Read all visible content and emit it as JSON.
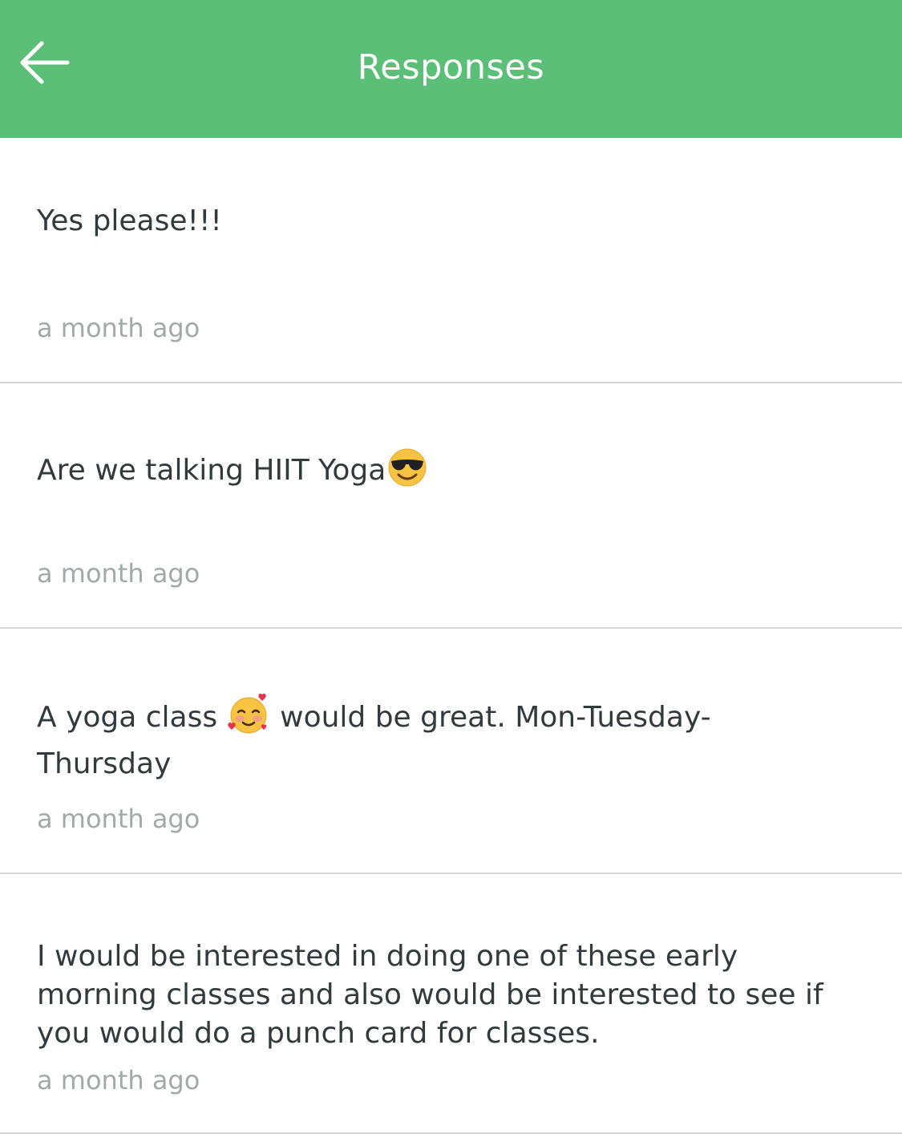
{
  "header": {
    "title": "Responses",
    "back_icon": "arrow-left-icon"
  },
  "colors": {
    "accent": "#5BBF77",
    "text": "#333A3D",
    "timestamp": "#A3A8AB",
    "divider": "#D6D6D6"
  },
  "responses": [
    {
      "text": "Yes please!!!",
      "time": "a month ago"
    },
    {
      "text_before": "Are we talking HIIT Yoga",
      "emoji": "smiling-face-with-sunglasses-icon",
      "time": "a month ago"
    },
    {
      "text_before": "A yoga class",
      "emoji": "smiling-face-with-hearts-icon",
      "text_after_line1": "would be great. Mon-Tuesday-",
      "text_line2": "Thursday",
      "time": "a month ago"
    },
    {
      "lines": [
        "I would be interested in doing one of these early",
        "morning classes and also would be interested to see if",
        "you would do a punch card for classes."
      ],
      "time": "a month ago"
    }
  ]
}
